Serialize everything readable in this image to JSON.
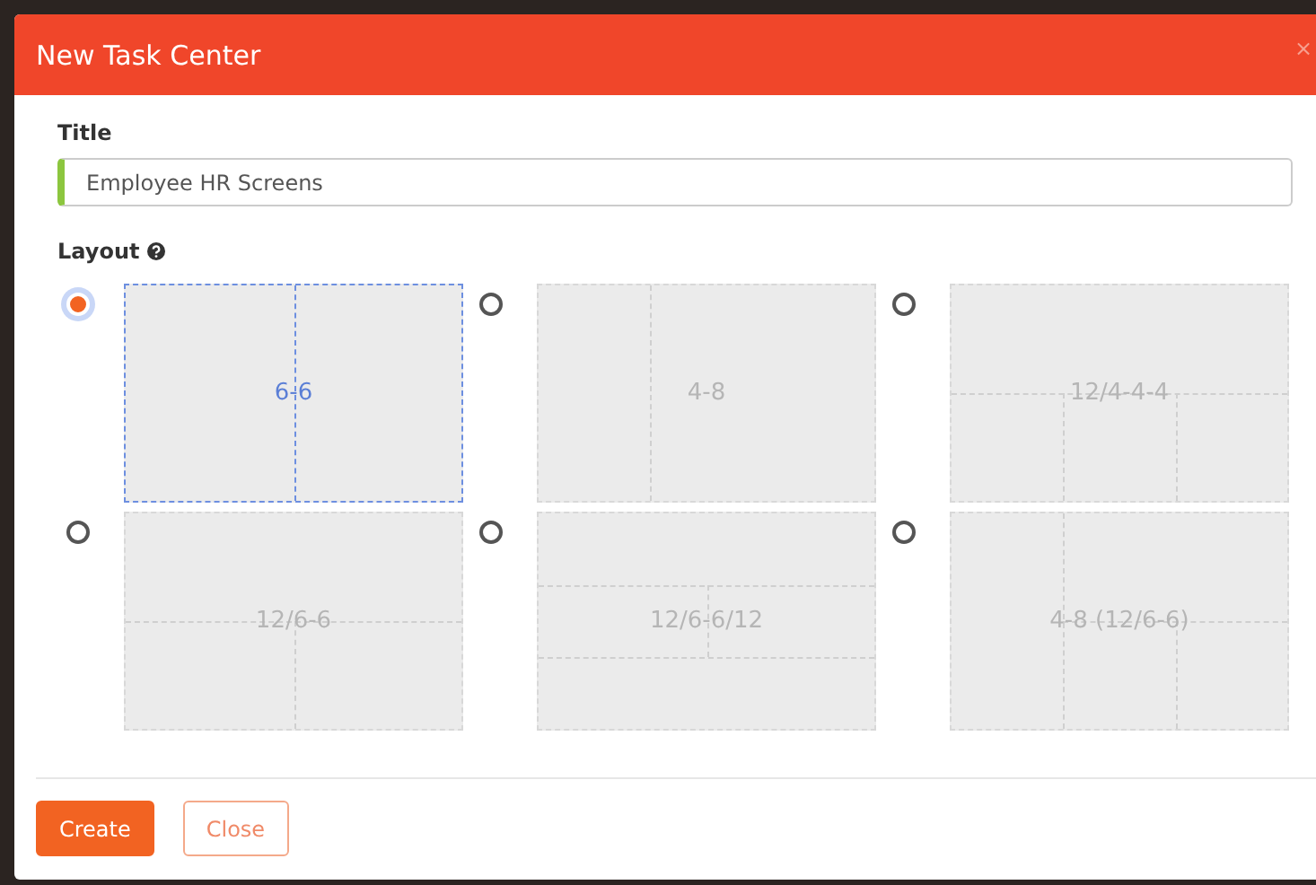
{
  "dialog": {
    "title": "New Task Center",
    "close": "×"
  },
  "title_field": {
    "label": "Title",
    "value": "Employee HR Screens"
  },
  "layout": {
    "label": "Layout",
    "options": [
      {
        "label": "6-6",
        "kind": "halves",
        "selected": true
      },
      {
        "label": "4-8",
        "kind": "third-left",
        "selected": false
      },
      {
        "label": "12/4-4-4",
        "kind": "top-thirds",
        "selected": false
      },
      {
        "label": "12/6-6",
        "kind": "top-halves",
        "selected": false
      },
      {
        "label": "12/6-6/12",
        "kind": "band-halves",
        "selected": false
      },
      {
        "label": "4-8 (12/6-6)",
        "kind": "left-third-split",
        "selected": false
      }
    ]
  },
  "buttons": [
    {
      "label": "Create",
      "kind": "primary"
    },
    {
      "label": "Close",
      "kind": "secondary"
    }
  ]
}
